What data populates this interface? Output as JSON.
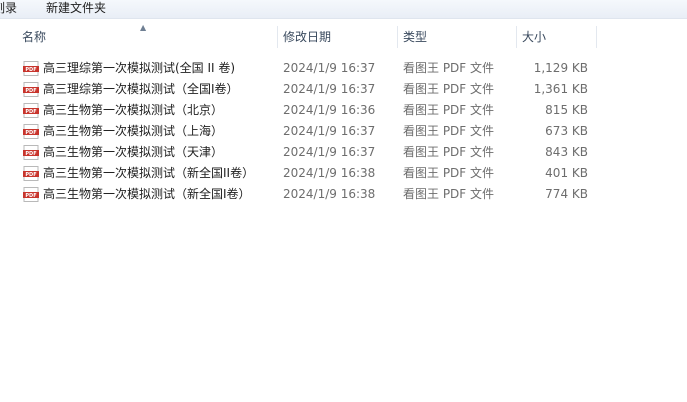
{
  "toolbar": {
    "clip_label": "刻录",
    "new_folder_label": "新建文件夹"
  },
  "columns": {
    "name": "名称",
    "date": "修改日期",
    "type": "类型",
    "size": "大小"
  },
  "colors": {
    "pdf_icon_red": "#c8342c",
    "header_text": "#3a4a5e",
    "detail_text": "#6d6d6d"
  },
  "files": [
    {
      "name": "高三理综第一次模拟测试(全国 II 卷)",
      "date": "2024/1/9 16:37",
      "type": "看图王 PDF 文件",
      "size": "1,129 KB",
      "icon": "pdf-icon"
    },
    {
      "name": "高三理综第一次模拟测试（全国I卷）",
      "date": "2024/1/9 16:37",
      "type": "看图王 PDF 文件",
      "size": "1,361 KB",
      "icon": "pdf-icon"
    },
    {
      "name": "高三生物第一次模拟测试（北京）",
      "date": "2024/1/9 16:36",
      "type": "看图王 PDF 文件",
      "size": "815 KB",
      "icon": "pdf-icon"
    },
    {
      "name": "高三生物第一次模拟测试（上海）",
      "date": "2024/1/9 16:37",
      "type": "看图王 PDF 文件",
      "size": "673 KB",
      "icon": "pdf-icon"
    },
    {
      "name": "高三生物第一次模拟测试（天津）",
      "date": "2024/1/9 16:37",
      "type": "看图王 PDF 文件",
      "size": "843 KB",
      "icon": "pdf-icon"
    },
    {
      "name": "高三生物第一次模拟测试（新全国II卷）",
      "date": "2024/1/9 16:38",
      "type": "看图王 PDF 文件",
      "size": "401 KB",
      "icon": "pdf-icon"
    },
    {
      "name": "高三生物第一次模拟测试（新全国I卷）",
      "date": "2024/1/9 16:38",
      "type": "看图王 PDF 文件",
      "size": "774 KB",
      "icon": "pdf-icon"
    }
  ]
}
